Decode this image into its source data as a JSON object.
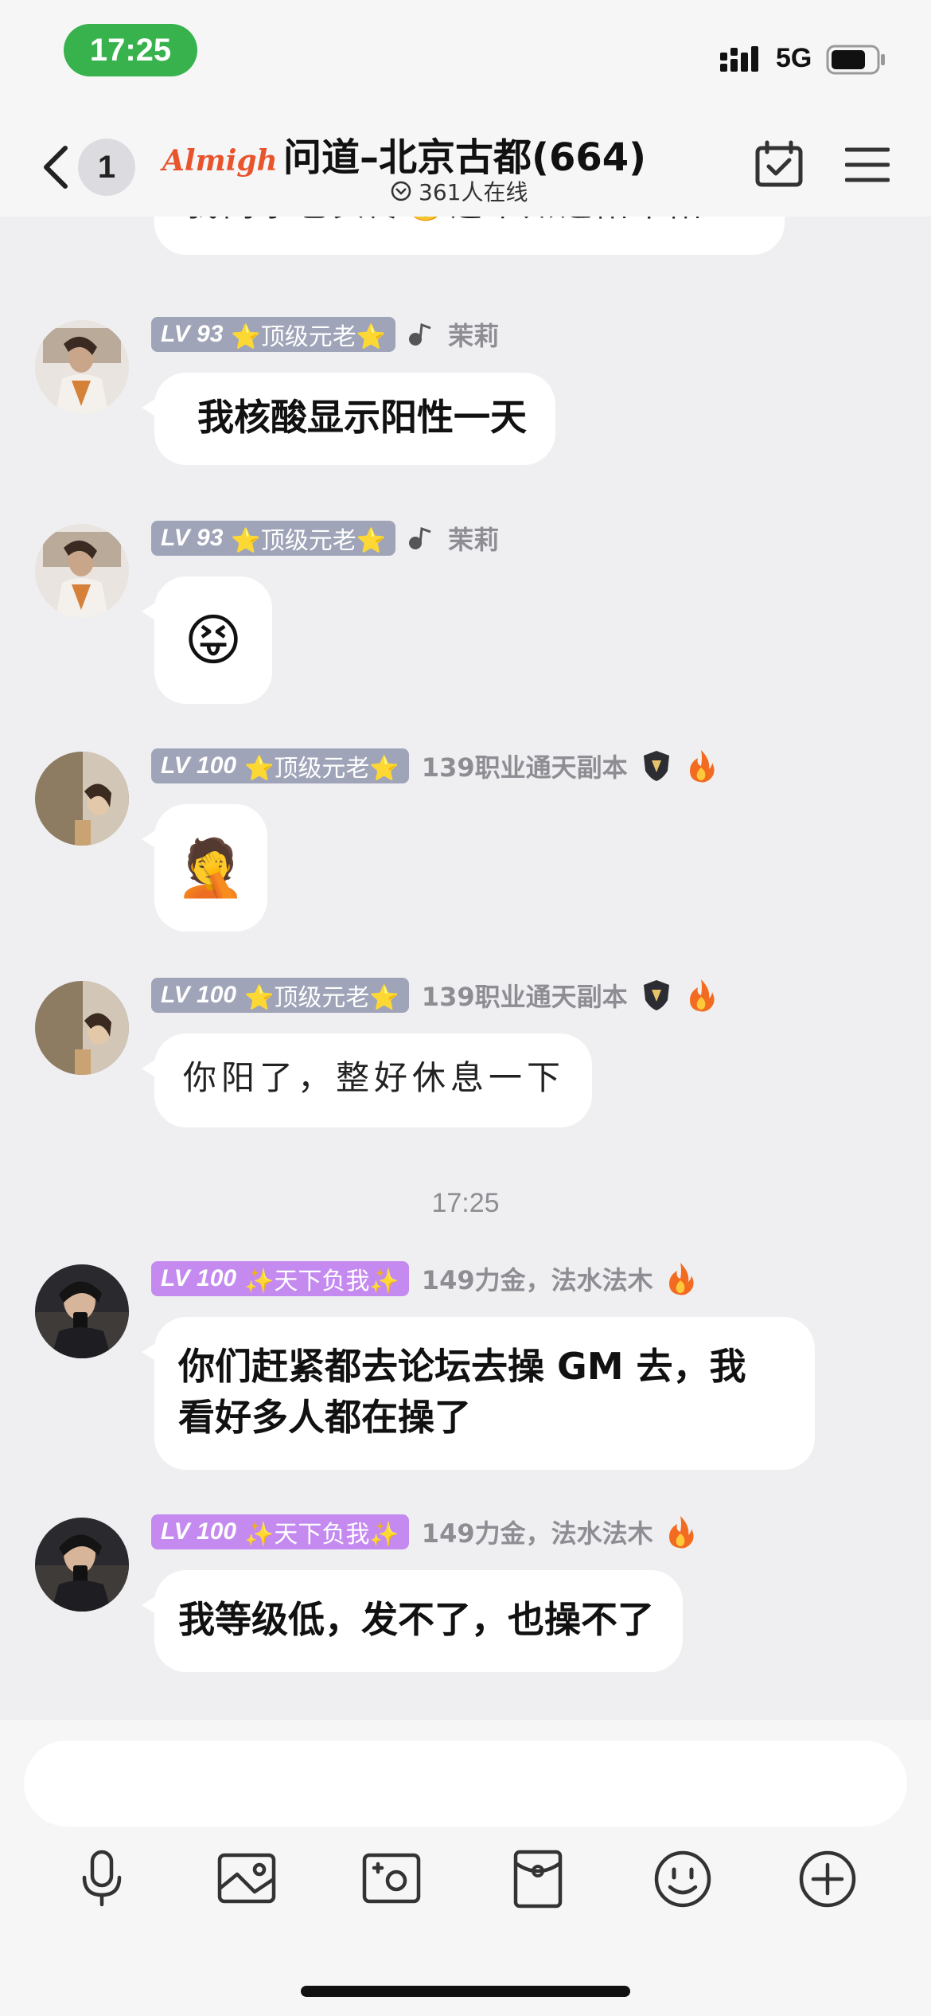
{
  "status_bar": {
    "time": "17:25",
    "network": "5G"
  },
  "header": {
    "unread_count": "1",
    "logo_text": "Almighty",
    "title": "问道–北京古都(664)",
    "online_text": "361人在线"
  },
  "messages": [
    {
      "text_partial": "我同事也头疼😵这个知道阳不阳"
    },
    {
      "level": "LV 93",
      "title": "⭐顶级元老⭐",
      "name": "茉莉",
      "text": "我核酸显示阳性一天"
    },
    {
      "level": "LV 93",
      "title": "⭐顶级元老⭐",
      "name": "茉莉",
      "emoji": "😝"
    },
    {
      "level": "LV 100",
      "title": "⭐顶级元老⭐",
      "name": "139职业通天副本",
      "emoji": "🤦"
    },
    {
      "level": "LV 100",
      "title": "⭐顶级元老⭐",
      "name": "139职业通天副本",
      "text": "你阳了，整好休息一下"
    },
    {
      "level": "LV 100",
      "title": "✨天下负我✨",
      "name": "149力金，法水法木",
      "text_line1": "你们赶紧都去论坛去操 GM 去，我",
      "text_line2": "看好多人都在操了"
    },
    {
      "level": "LV 100",
      "title": "✨天下负我✨",
      "name": "149力金，法水法木",
      "text": "我等级低，发不了，也操不了"
    }
  ],
  "time_divider": "17:25",
  "input": {
    "value": "",
    "placeholder": ""
  },
  "toolbar": [
    "microphone-icon",
    "image-icon",
    "camera-icon",
    "red-packet-icon",
    "emoji-icon",
    "plus-icon"
  ],
  "colors": {
    "time_pill": "#37b24d",
    "badge_gray": "#9fa4b8",
    "badge_purple": "#c48af0",
    "background": "#efeff1"
  }
}
